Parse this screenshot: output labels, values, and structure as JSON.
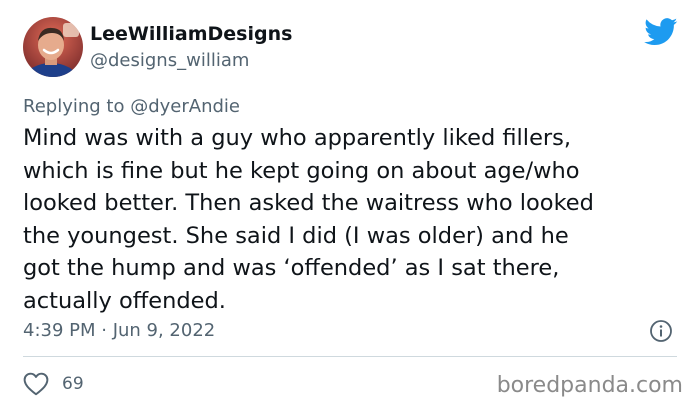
{
  "author": {
    "display_name": "LeeWilliamDesigns",
    "handle": "@designs_william"
  },
  "reply": {
    "prefix": "Replying to",
    "mention": "@dyerAndie"
  },
  "tweet": {
    "lines": [
      "Mind was with a guy who apparently liked fillers,",
      "which is fine but he kept going on about age/who",
      "looked better. Then asked the waitress who looked",
      "the youngest. She said I did (I was older) and he",
      "got the hump and was ‘offended’ as I sat there,",
      "actually offended."
    ],
    "timestamp": "4:39 PM · Jun 9, 2022"
  },
  "engagement": {
    "likes": "69"
  },
  "watermark": "boredpanda.com",
  "icons": {
    "brand": "twitter-bird-icon",
    "info": "info-icon",
    "like": "heart-icon"
  },
  "colors": {
    "twitter_blue": "#1d9bf0",
    "secondary_text": "#536471",
    "divider": "#cfd9de"
  }
}
